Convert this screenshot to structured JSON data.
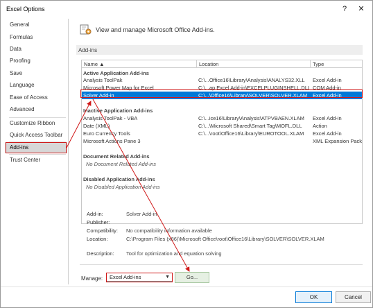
{
  "window": {
    "title": "Excel Options",
    "help_label": "?",
    "close_label": "✕"
  },
  "sidebar": {
    "items": [
      {
        "label": "General"
      },
      {
        "label": "Formulas"
      },
      {
        "label": "Data"
      },
      {
        "label": "Proofing"
      },
      {
        "label": "Save"
      },
      {
        "label": "Language"
      },
      {
        "label": "Ease of Access"
      },
      {
        "label": "Advanced"
      },
      {
        "label": "Customize Ribbon"
      },
      {
        "label": "Quick Access Toolbar"
      },
      {
        "label": "Add-ins"
      },
      {
        "label": "Trust Center"
      }
    ],
    "selected": "Add-ins"
  },
  "header": {
    "icon": "add-ins-gear-icon",
    "text": "View and manage Microsoft Office Add-ins."
  },
  "addins_section": {
    "title": "Add-ins"
  },
  "grid": {
    "columns": {
      "name": "Name ▲",
      "location": "Location",
      "type": "Type"
    },
    "groups": {
      "active": "Active Application Add-ins",
      "inactive": "Inactive Application Add-ins",
      "document": "Document Related Add-ins",
      "disabled": "Disabled Application Add-ins"
    },
    "active_rows": [
      {
        "name": "Analysis ToolPak",
        "location": "C:\\...Office16\\Library\\Analysis\\ANALYS32.XLL",
        "type": "Excel Add-in"
      },
      {
        "name": "Microsoft Power Map for Excel",
        "location": "C:\\...ap Excel Add-in\\EXCELPLUGINSHELL.DLL",
        "type": "COM Add-in"
      },
      {
        "name": "Solver Add-in",
        "location": "C:\\...\\Office16\\Library\\SOLVER\\SOLVER.XLAM",
        "type": "Excel Add-in"
      }
    ],
    "inactive_rows": [
      {
        "name": "Analysis ToolPak - VBA",
        "location": "C:\\...ice16\\Library\\Analysis\\ATPVBAEN.XLAM",
        "type": "Excel Add-in"
      },
      {
        "name": "Date (XML)",
        "location": "C:\\...\\Microsoft Shared\\Smart Tag\\MOFL.DLL",
        "type": "Action"
      },
      {
        "name": "Euro Currency Tools",
        "location": "C:\\...\\root\\Office16\\Library\\EUROTOOL.XLAM",
        "type": "Excel Add-in"
      },
      {
        "name": "Microsoft Actions Pane 3",
        "location": "",
        "type": "XML Expansion Pack"
      }
    ],
    "document_empty": "No Document Related Add-ins",
    "disabled_empty": "No Disabled Application Add-ins"
  },
  "details": {
    "addin_label": "Add-in:",
    "addin_value": "Solver Add-in",
    "publisher_label": "Publisher:",
    "publisher_value": "",
    "compat_label": "Compatibility:",
    "compat_value": "No compatibility information available",
    "location_label": "Location:",
    "location_value": "C:\\Program Files (x86)\\Microsoft Office\\root\\Office16\\Library\\SOLVER\\SOLVER.XLAM",
    "desc_label": "Description:",
    "desc_value": "Tool for optimization and equation solving"
  },
  "manage": {
    "label": "Manage:",
    "selected": "Excel Add-ins",
    "go_label": "Go..."
  },
  "footer": {
    "ok_label": "OK",
    "cancel_label": "Cancel"
  },
  "colors": {
    "selection": "#0078d7",
    "annotation": "#d01818",
    "selected_sidebar": "#d7d7d7"
  }
}
